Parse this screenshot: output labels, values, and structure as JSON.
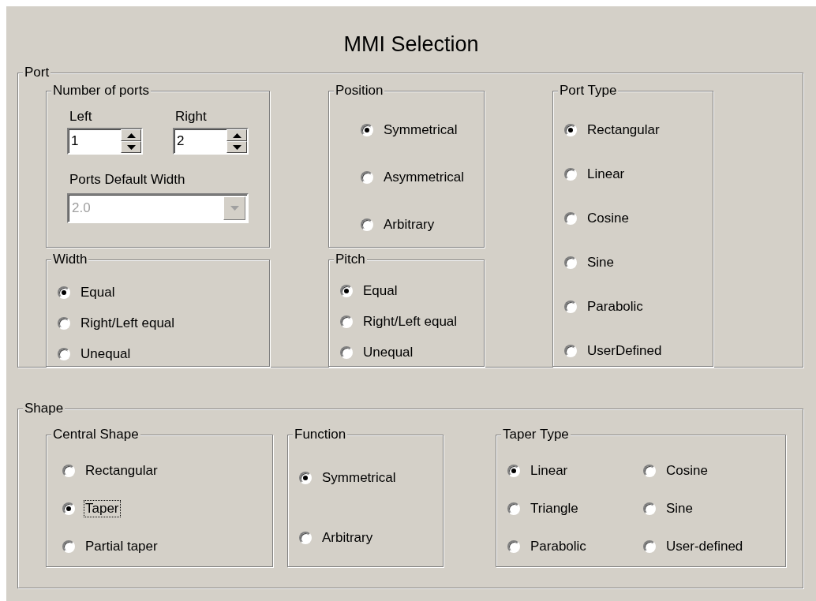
{
  "title": "MMI Selection",
  "port": {
    "label": "Port",
    "number_of_ports": {
      "label": "Number of ports",
      "left": {
        "label": "Left",
        "value": "1"
      },
      "right": {
        "label": "Right",
        "value": "2"
      },
      "default_width": {
        "label": "Ports Default Width",
        "value": "2.0",
        "disabled": true
      }
    },
    "width": {
      "label": "Width",
      "options": [
        {
          "label": "Equal",
          "selected": true
        },
        {
          "label": "Right/Left equal",
          "selected": false
        },
        {
          "label": "Unequal",
          "selected": false
        }
      ]
    },
    "position": {
      "label": "Position",
      "options": [
        {
          "label": "Symmetrical",
          "selected": true
        },
        {
          "label": "Asymmetrical",
          "selected": false
        },
        {
          "label": "Arbitrary",
          "selected": false
        }
      ]
    },
    "pitch": {
      "label": "Pitch",
      "options": [
        {
          "label": "Equal",
          "selected": true
        },
        {
          "label": "Right/Left equal",
          "selected": false
        },
        {
          "label": "Unequal",
          "selected": false
        }
      ]
    },
    "port_type": {
      "label": "Port Type",
      "options": [
        {
          "label": "Rectangular",
          "selected": true
        },
        {
          "label": "Linear",
          "selected": false
        },
        {
          "label": "Cosine",
          "selected": false
        },
        {
          "label": "Sine",
          "selected": false
        },
        {
          "label": "Parabolic",
          "selected": false
        },
        {
          "label": "UserDefined",
          "selected": false
        }
      ]
    }
  },
  "shape": {
    "label": "Shape",
    "central_shape": {
      "label": "Central Shape",
      "options": [
        {
          "label": "Rectangular",
          "selected": false,
          "focused": false
        },
        {
          "label": "Taper",
          "selected": true,
          "focused": true
        },
        {
          "label": "Partial taper",
          "selected": false,
          "focused": false
        }
      ]
    },
    "function": {
      "label": "Function",
      "options": [
        {
          "label": "Symmetrical",
          "selected": true
        },
        {
          "label": "Arbitrary",
          "selected": false
        }
      ]
    },
    "taper_type": {
      "label": "Taper Type",
      "options": [
        {
          "label": "Linear",
          "selected": true
        },
        {
          "label": "Triangle",
          "selected": false
        },
        {
          "label": "Parabolic",
          "selected": false
        },
        {
          "label": "Cosine",
          "selected": false
        },
        {
          "label": "Sine",
          "selected": false
        },
        {
          "label": "User-defined",
          "selected": false
        }
      ]
    }
  }
}
